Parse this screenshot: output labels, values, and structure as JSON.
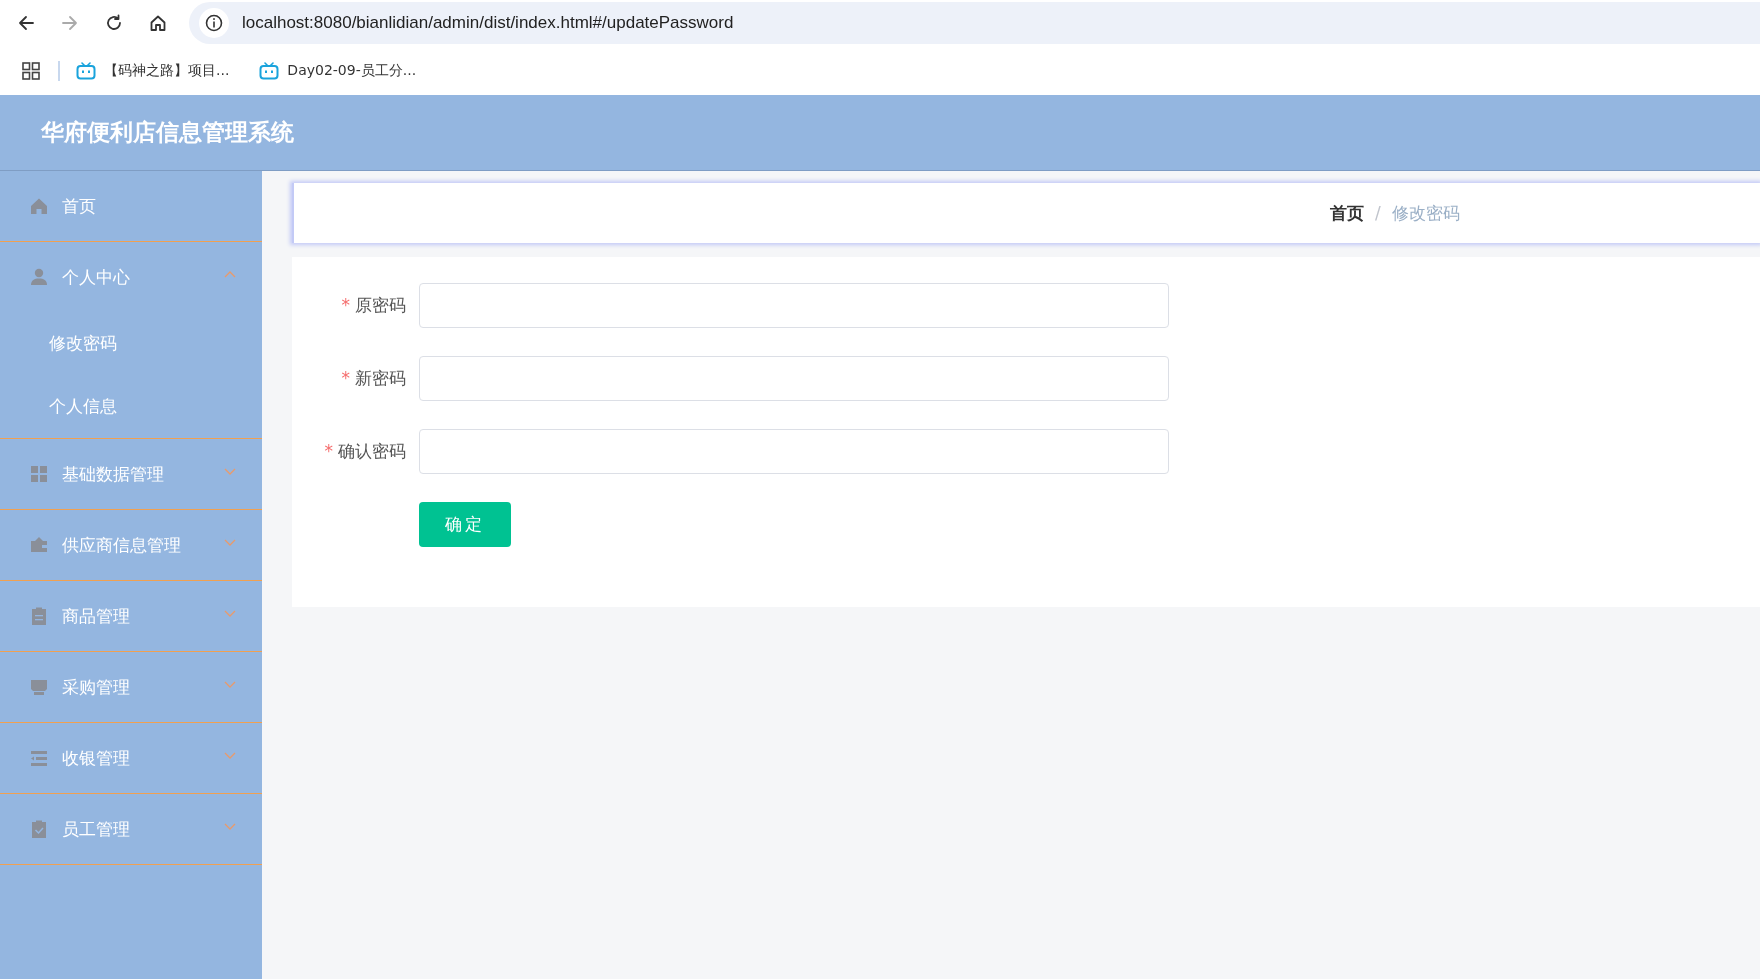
{
  "browser": {
    "url": "localhost:8080/bianlidian/admin/dist/index.html#/updatePassword",
    "bookmarks": [
      {
        "label": "【码神之路】项目..."
      },
      {
        "label": "Day02-09-员工分..."
      }
    ]
  },
  "app_title": "华府便利店信息管理系统",
  "sidebar": {
    "items": [
      {
        "label": "首页"
      },
      {
        "label": "个人中心",
        "expanded": true,
        "children": [
          {
            "label": "修改密码"
          },
          {
            "label": "个人信息"
          }
        ]
      },
      {
        "label": "基础数据管理",
        "expanded": false
      },
      {
        "label": "供应商信息管理",
        "expanded": false
      },
      {
        "label": "商品管理",
        "expanded": false
      },
      {
        "label": "采购管理",
        "expanded": false
      },
      {
        "label": "收银管理",
        "expanded": false
      },
      {
        "label": "员工管理",
        "expanded": false
      }
    ]
  },
  "breadcrumb": {
    "separator": "/",
    "items": [
      {
        "label": "首页",
        "current": false
      },
      {
        "label": "修改密码",
        "current": true
      }
    ]
  },
  "form": {
    "fields": [
      {
        "label": "原密码",
        "required_mark": "*"
      },
      {
        "label": "新密码",
        "required_mark": "*"
      },
      {
        "label": "确认密码",
        "required_mark": "*"
      }
    ],
    "submit": "确定"
  }
}
